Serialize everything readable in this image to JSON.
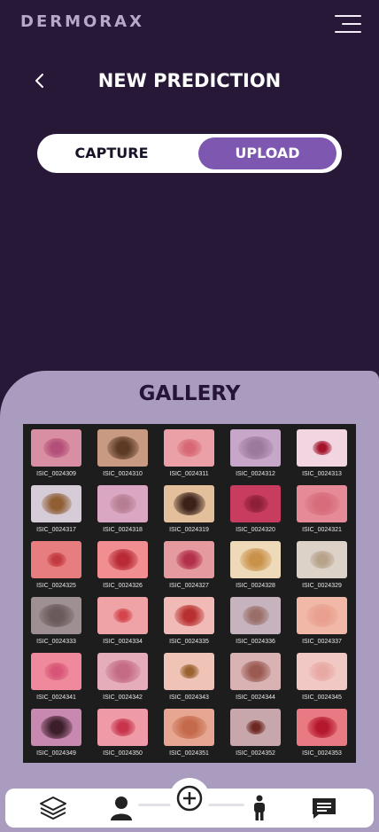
{
  "app": {
    "brand": "DERMORAX"
  },
  "header": {
    "title": "NEW PREDICTION"
  },
  "mode_toggle": {
    "capture_label": "CAPTURE",
    "upload_label": "UPLOAD",
    "selected": "UPLOAD"
  },
  "gallery": {
    "title": "GALLERY",
    "images": [
      {
        "id": "ISIC_0024309",
        "bg": "#d98fa3",
        "lesion": "#b34e78"
      },
      {
        "id": "ISIC_0024310",
        "bg": "#c99a82",
        "lesion": "#5c3a24"
      },
      {
        "id": "ISIC_0024311",
        "bg": "#eaa0a6",
        "lesion": "#d76873"
      },
      {
        "id": "ISIC_0024312",
        "bg": "#c6a6c9",
        "lesion": "#9c7a9e"
      },
      {
        "id": "ISIC_0024313",
        "bg": "#f1d6e2",
        "lesion": "#a3132a"
      },
      {
        "id": "ISIC_0024317",
        "bg": "#d6ccd8",
        "lesion": "#8f5e33"
      },
      {
        "id": "ISIC_0024318",
        "bg": "#d9a7c2",
        "lesion": "#b77e93"
      },
      {
        "id": "ISIC_0024319",
        "bg": "#e4bf9c",
        "lesion": "#3a2219"
      },
      {
        "id": "ISIC_0024320",
        "bg": "#c73c5f",
        "lesion": "#8e1f3a"
      },
      {
        "id": "ISIC_0024321",
        "bg": "#e58a96",
        "lesion": "#d76c7b"
      },
      {
        "id": "ISIC_0024325",
        "bg": "#e77d7e",
        "lesion": "#c23a41"
      },
      {
        "id": "ISIC_0024326",
        "bg": "#f08e92",
        "lesion": "#b82a35"
      },
      {
        "id": "ISIC_0024327",
        "bg": "#e59aa0",
        "lesion": "#b22f4a"
      },
      {
        "id": "ISIC_0024328",
        "bg": "#eed9b9",
        "lesion": "#c9924a"
      },
      {
        "id": "ISIC_0024329",
        "bg": "#ddd2c8",
        "lesion": "#b7a28a"
      },
      {
        "id": "ISIC_0024333",
        "bg": "#9d8f92",
        "lesion": "#6b5a5c"
      },
      {
        "id": "ISIC_0024334",
        "bg": "#f0a3a6",
        "lesion": "#d4454d"
      },
      {
        "id": "ISIC_0024335",
        "bg": "#f2bab6",
        "lesion": "#b8302f"
      },
      {
        "id": "ISIC_0024336",
        "bg": "#c6b3bd",
        "lesion": "#9a6f6a"
      },
      {
        "id": "ISIC_0024337",
        "bg": "#f1b8a8",
        "lesion": "#e9a08e"
      },
      {
        "id": "ISIC_0024341",
        "bg": "#ee8a9b",
        "lesion": "#d85577"
      },
      {
        "id": "ISIC_0024342",
        "bg": "#e5adba",
        "lesion": "#c46b86"
      },
      {
        "id": "ISIC_0024343",
        "bg": "#efc3b6",
        "lesion": "#9a6230"
      },
      {
        "id": "ISIC_0024344",
        "bg": "#d9b2b4",
        "lesion": "#9a5a51"
      },
      {
        "id": "ISIC_0024345",
        "bg": "#f2c8c4",
        "lesion": "#e7a9a4"
      },
      {
        "id": "ISIC_0024349",
        "bg": "#c889b0",
        "lesion": "#3c1e2a"
      },
      {
        "id": "ISIC_0024350",
        "bg": "#ef9aa7",
        "lesion": "#c7344c"
      },
      {
        "id": "ISIC_0024351",
        "bg": "#e6a691",
        "lesion": "#c46a4a"
      },
      {
        "id": "ISIC_0024352",
        "bg": "#c8a7ac",
        "lesion": "#6e2a22"
      },
      {
        "id": "ISIC_0024353",
        "bg": "#e97a83",
        "lesion": "#b5172d"
      }
    ]
  },
  "bottom_nav": {
    "items": [
      {
        "name": "layers-icon"
      },
      {
        "name": "user-icon"
      },
      {
        "name": "add-circle-icon"
      },
      {
        "name": "person-standing-icon"
      },
      {
        "name": "chat-icon"
      }
    ]
  },
  "colors": {
    "background": "#271838",
    "panel": "#aa9cbf",
    "accent": "#7e57b0"
  }
}
